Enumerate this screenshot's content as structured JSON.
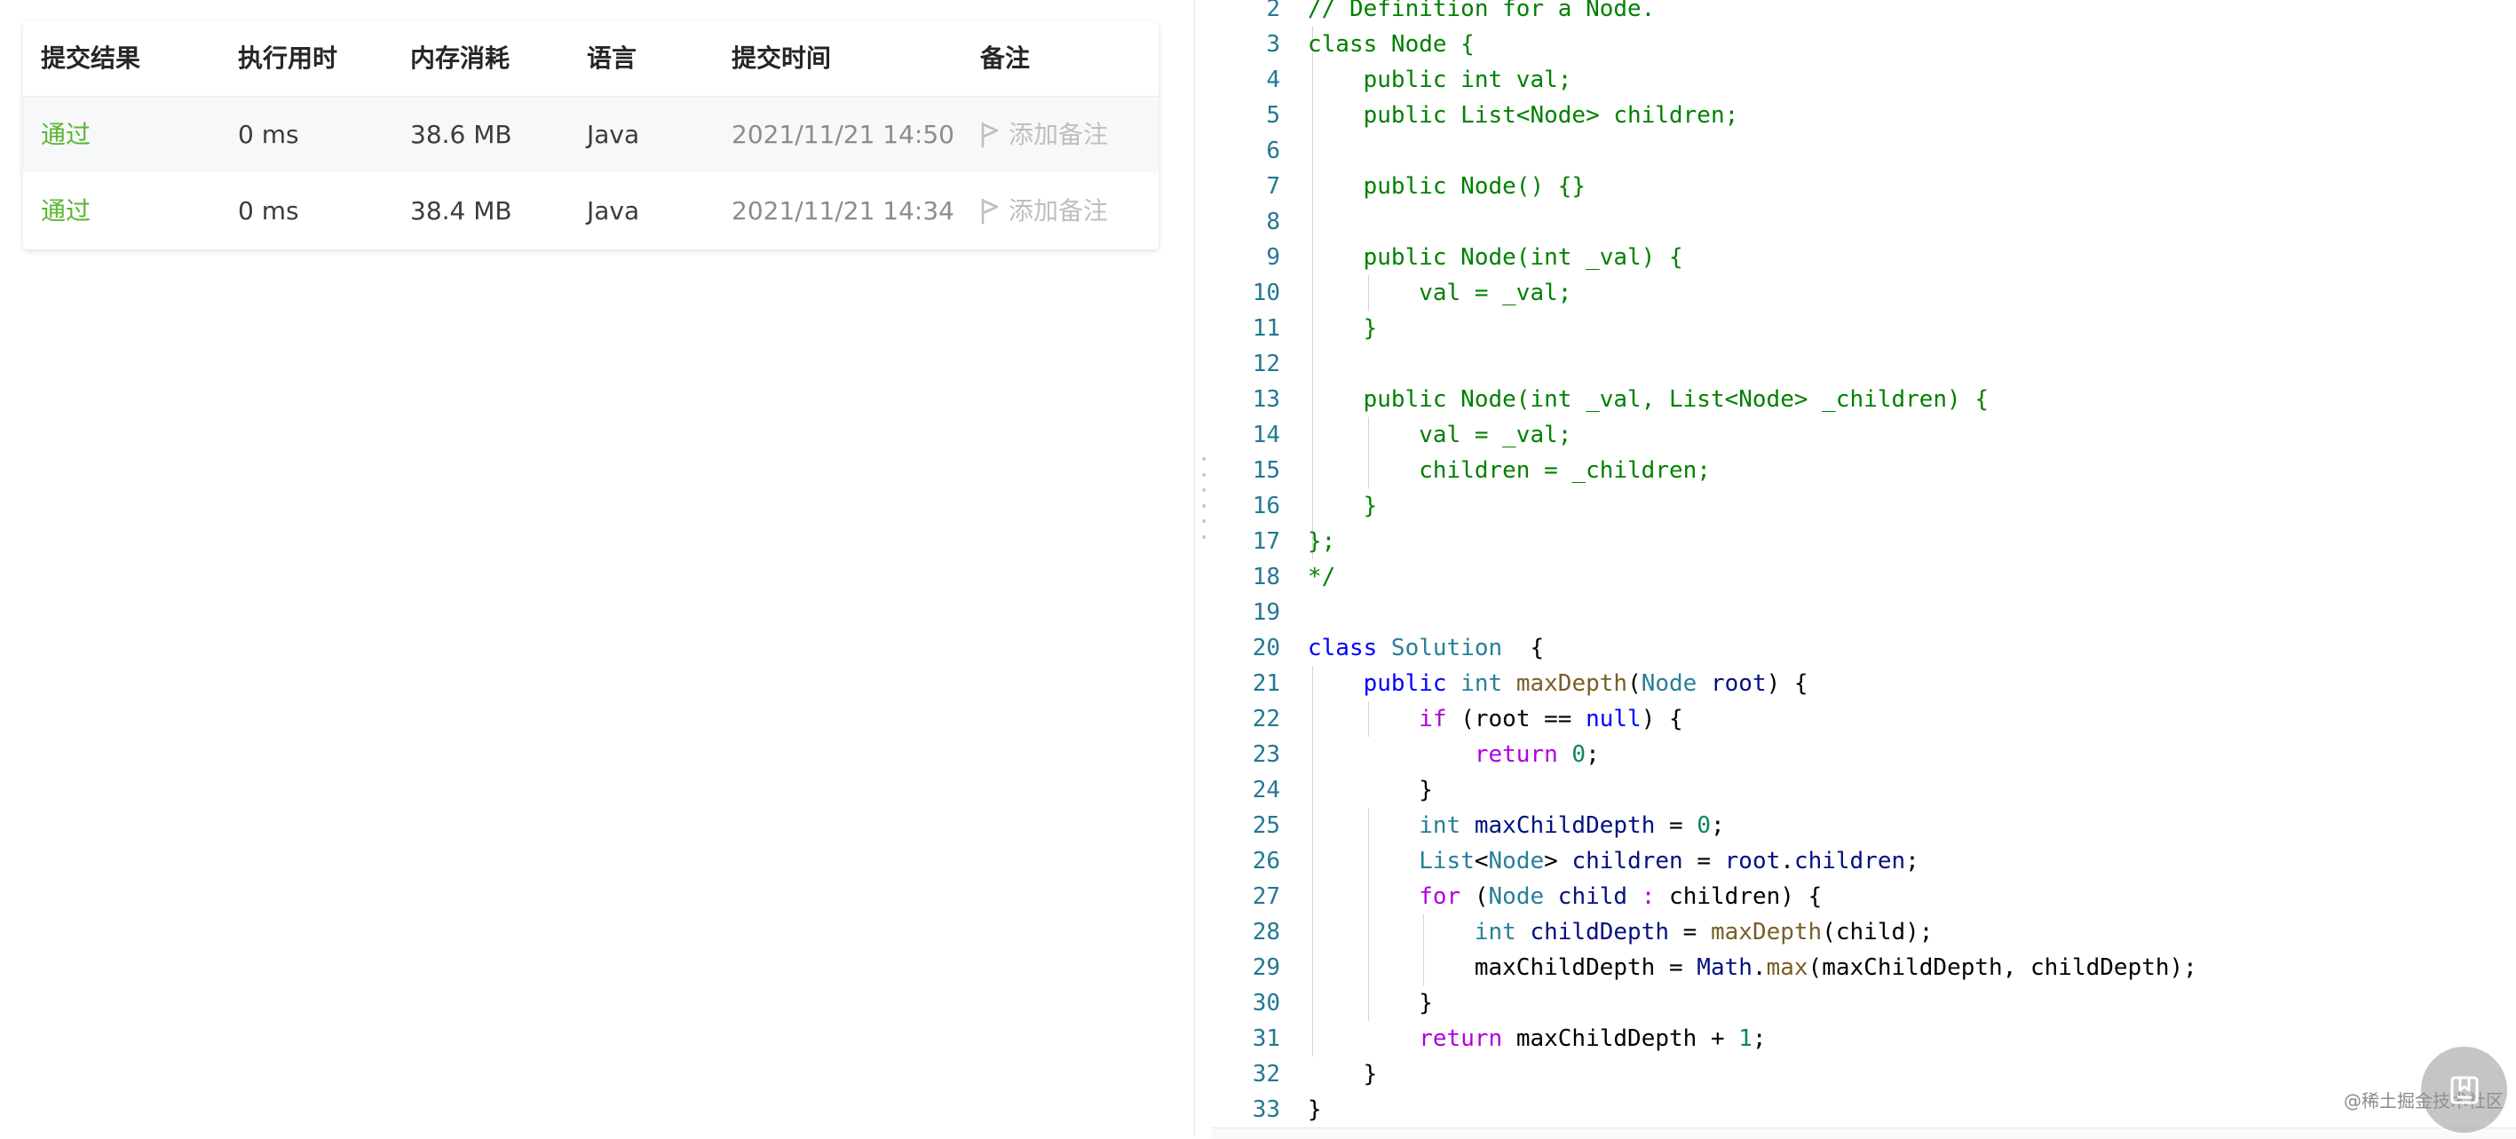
{
  "submissions": {
    "headers": {
      "status": "提交结果",
      "runtime": "执行用时",
      "memory": "内存消耗",
      "language": "语言",
      "submit_time": "提交时间",
      "note": "备注"
    },
    "rows": [
      {
        "status": "通过",
        "runtime": "0 ms",
        "memory": "38.6 MB",
        "language": "Java",
        "submit_time": "2021/11/21 14:50",
        "note": "添加备注"
      },
      {
        "status": "通过",
        "runtime": "0 ms",
        "memory": "38.4 MB",
        "language": "Java",
        "submit_time": "2021/11/21 14:34",
        "note": "添加备注"
      }
    ],
    "colors": {
      "pass": "#5cb531",
      "row_highlight": "#f7f8fa"
    }
  },
  "editor": {
    "line_numbers": [
      "2",
      "3",
      "4",
      "5",
      "6",
      "7",
      "8",
      "9",
      "10",
      "11",
      "12",
      "13",
      "14",
      "15",
      "16",
      "17",
      "18",
      "19",
      "20",
      "21",
      "22",
      "23",
      "24",
      "25",
      "26",
      "27",
      "28",
      "29",
      "30",
      "31",
      "32",
      "33"
    ],
    "colors": {
      "comment": "#008000",
      "keyword": "#0000ff",
      "control": "#af00db",
      "type": "#267f99",
      "function": "#795e26",
      "variable": "#001080",
      "number": "#098658",
      "line_number": "#237893"
    }
  },
  "watermark": {
    "text": "@稀土掘金技术社区",
    "icon": "juejin-logo-icon"
  }
}
